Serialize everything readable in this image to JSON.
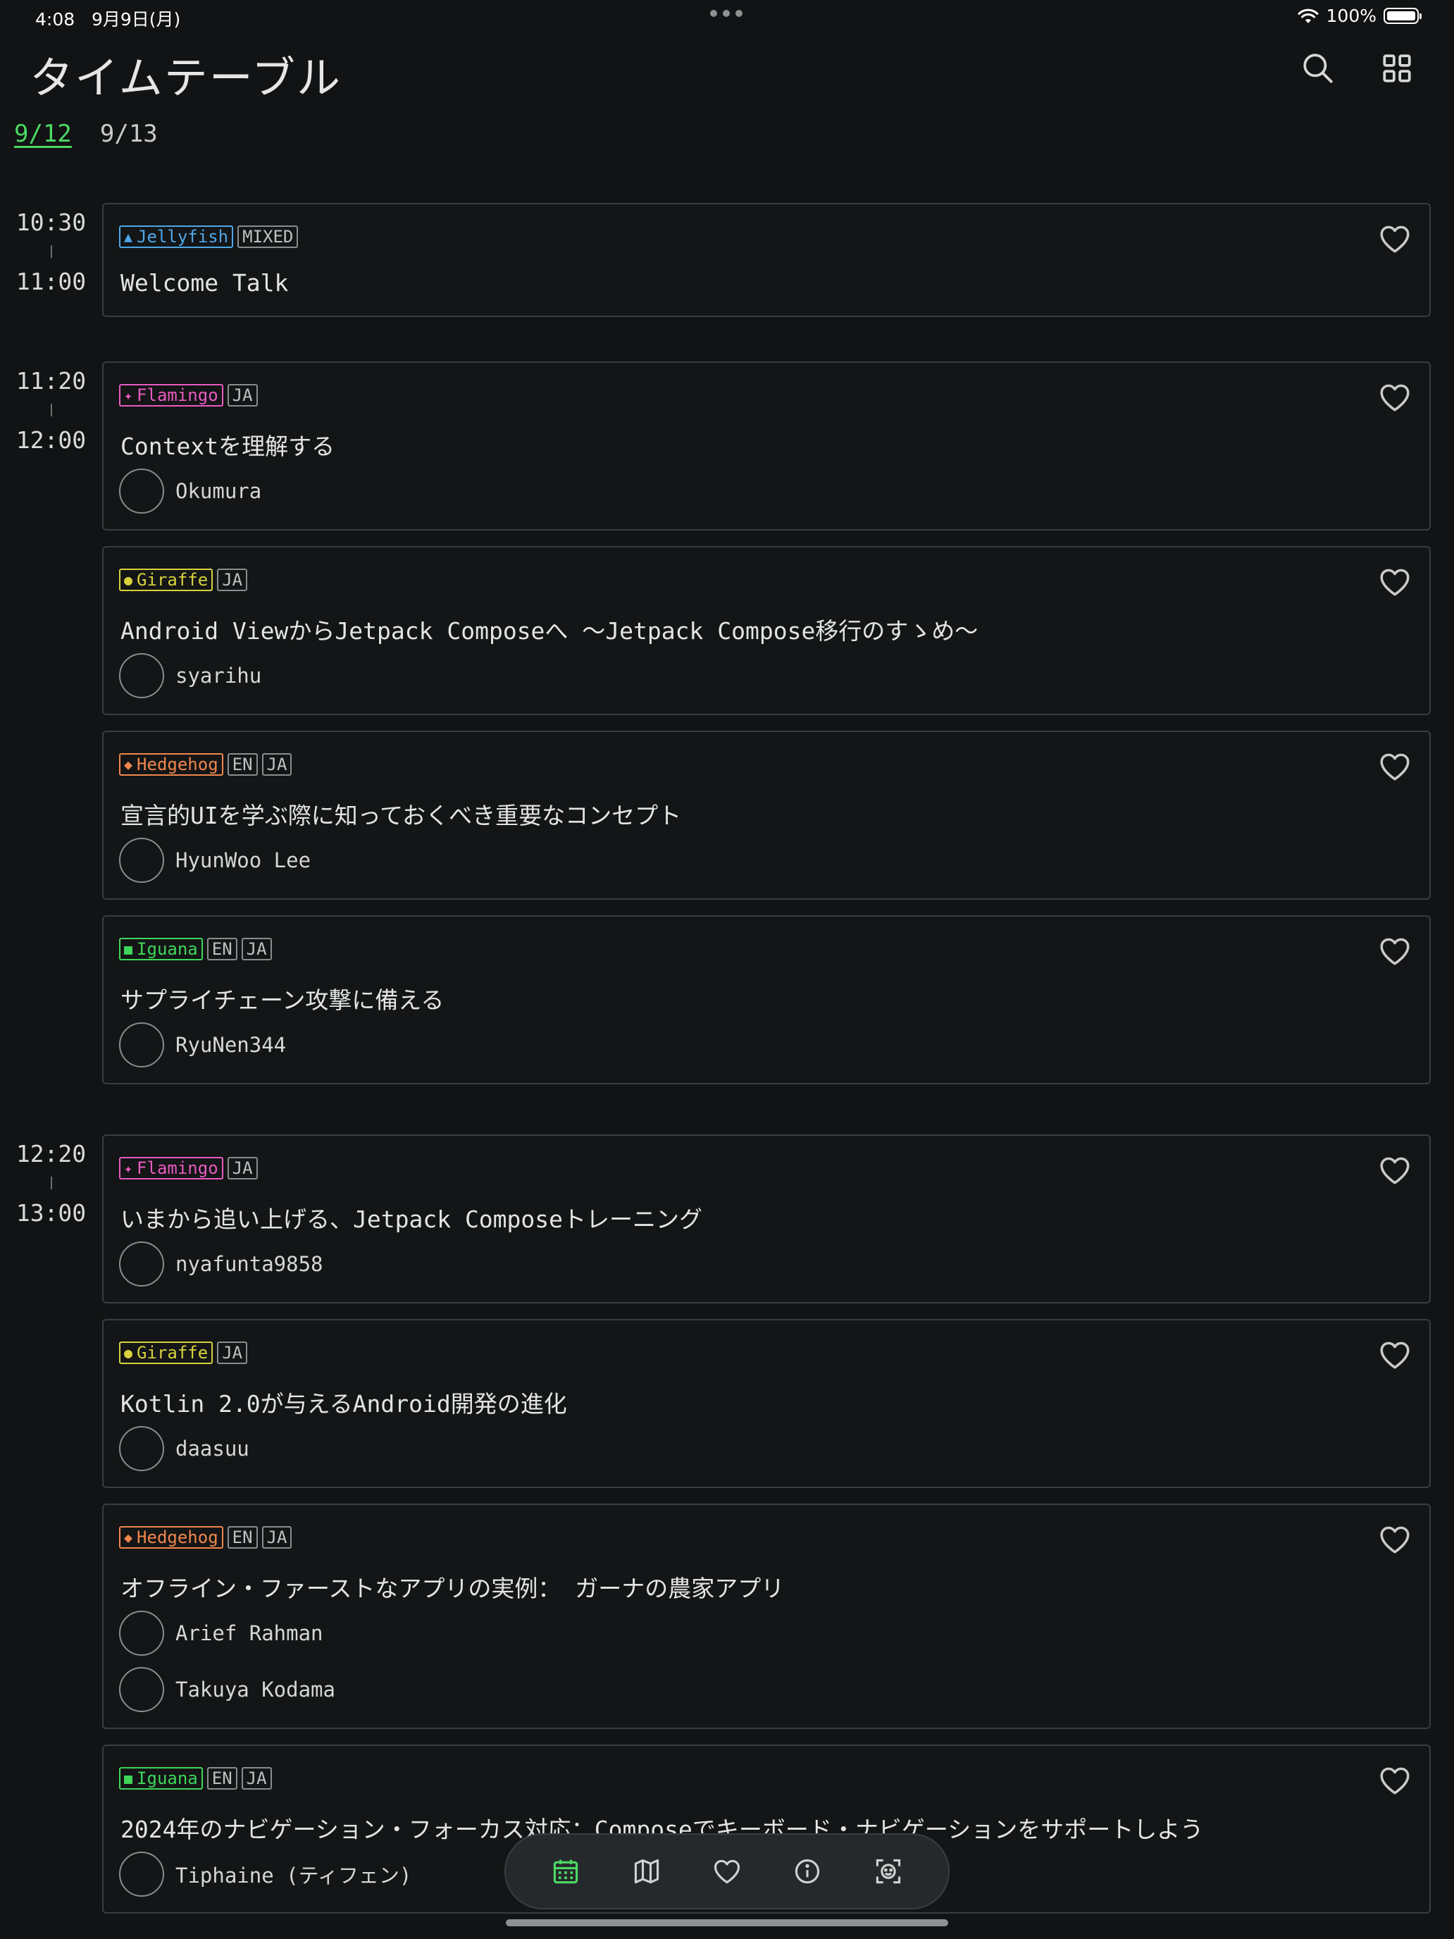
{
  "status_bar": {
    "time": "4:08",
    "date": "9月9日(月)",
    "battery": "100%"
  },
  "header": {
    "title": "タイムテーブル"
  },
  "day_tabs": [
    {
      "label": "9/12",
      "active": true
    },
    {
      "label": "9/13",
      "active": false
    }
  ],
  "colors": {
    "accent": "#4cd964",
    "Jellyfish": "#4fa7e8",
    "Flamingo": "#e85bc0",
    "Giraffe": "#d8d23c",
    "Hedgehog": "#f0874d",
    "Iguana": "#3fd65a"
  },
  "rooms": {
    "Jellyfish": {
      "name": "Jellyfish",
      "shape": "▲"
    },
    "Flamingo": {
      "name": "Flamingo",
      "shape": "✦"
    },
    "Giraffe": {
      "name": "Giraffe",
      "shape": "●"
    },
    "Hedgehog": {
      "name": "Hedgehog",
      "shape": "◆"
    },
    "Iguana": {
      "name": "Iguana",
      "shape": "■"
    }
  },
  "slots": [
    {
      "start": "10:30",
      "end": "11:00",
      "sessions": [
        {
          "room": "Jellyfish",
          "langs": [
            "MIXED"
          ],
          "title": "Welcome Talk",
          "speakers": []
        }
      ]
    },
    {
      "start": "11:20",
      "end": "12:00",
      "sessions": [
        {
          "room": "Flamingo",
          "langs": [
            "JA"
          ],
          "title": "Contextを理解する",
          "speakers": [
            "Okumura"
          ]
        },
        {
          "room": "Giraffe",
          "langs": [
            "JA"
          ],
          "title": "Android ViewからJetpack Composeへ ～Jetpack Compose移行のすゝめ～",
          "speakers": [
            "syarihu"
          ]
        },
        {
          "room": "Hedgehog",
          "langs": [
            "EN",
            "JA"
          ],
          "title": "宣言的UIを学ぶ際に知っておくべき重要なコンセプト",
          "speakers": [
            "HyunWoo Lee"
          ]
        },
        {
          "room": "Iguana",
          "langs": [
            "EN",
            "JA"
          ],
          "title": "サプライチェーン攻撃に備える",
          "speakers": [
            "RyuNen344"
          ]
        }
      ]
    },
    {
      "start": "12:20",
      "end": "13:00",
      "sessions": [
        {
          "room": "Flamingo",
          "langs": [
            "JA"
          ],
          "title": "いまから追い上げる、Jetpack Composeトレーニング",
          "speakers": [
            "nyafunta9858"
          ]
        },
        {
          "room": "Giraffe",
          "langs": [
            "JA"
          ],
          "title": "Kotlin 2.0が与えるAndroid開発の進化",
          "speakers": [
            "daasuu"
          ]
        },
        {
          "room": "Hedgehog",
          "langs": [
            "EN",
            "JA"
          ],
          "title": "オフライン・ファーストなアプリの実例： ガーナの農家アプリ",
          "speakers": [
            "Arief Rahman",
            "Takuya Kodama"
          ]
        },
        {
          "room": "Iguana",
          "langs": [
            "EN",
            "JA"
          ],
          "title": "2024年のナビゲーション・フォーカス対応：Composeでキーボード・ナビゲーションをサポートしよう",
          "speakers": [
            "Tiphaine (ティフェン)"
          ]
        }
      ]
    }
  ],
  "bottom_nav": [
    {
      "name": "timetable",
      "icon": "calendar-icon",
      "active": true
    },
    {
      "name": "floor-map",
      "icon": "map-icon",
      "active": false
    },
    {
      "name": "favorites",
      "icon": "heart-icon",
      "active": false
    },
    {
      "name": "about",
      "icon": "info-icon",
      "active": false
    },
    {
      "name": "profile-card",
      "icon": "face-scan-icon",
      "active": false
    }
  ]
}
